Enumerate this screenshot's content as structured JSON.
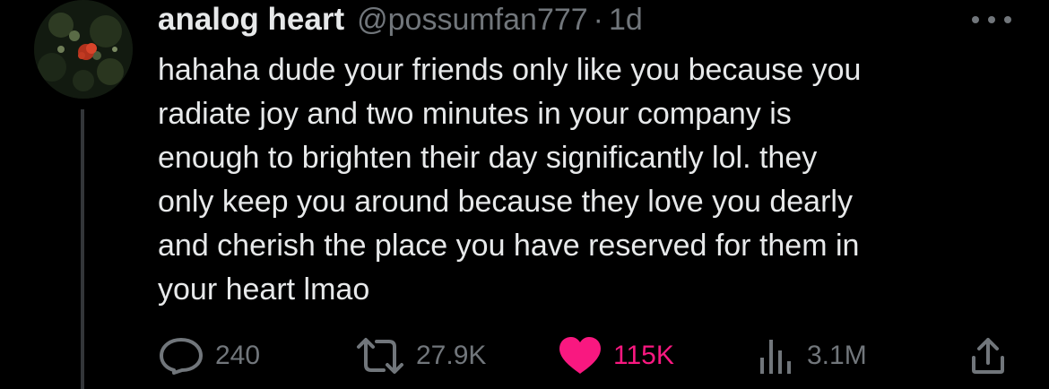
{
  "tweet": {
    "author_name": "analog heart",
    "handle": "@possumfan777",
    "separator": "·",
    "time": "1d",
    "text_lines": [
      "hahaha dude your friends only like you because you",
      "radiate joy and two minutes in your company is",
      "enough to brighten their day significantly lol. they",
      "only keep you around because they love you dearly",
      "and cherish the place you have reserved for them in",
      "your heart lmao"
    ]
  },
  "actions": {
    "replies": "240",
    "retweets": "27.9K",
    "likes": "115K",
    "views": "3.1M"
  },
  "icons": {
    "reply": "reply-icon",
    "retweet": "retweet-icon",
    "like": "heart-icon",
    "views": "views-icon",
    "share": "share-icon",
    "more": "more-icon"
  },
  "colors": {
    "background": "#000000",
    "text": "#e7e9ea",
    "muted": "#71767b",
    "like": "#f91880"
  }
}
